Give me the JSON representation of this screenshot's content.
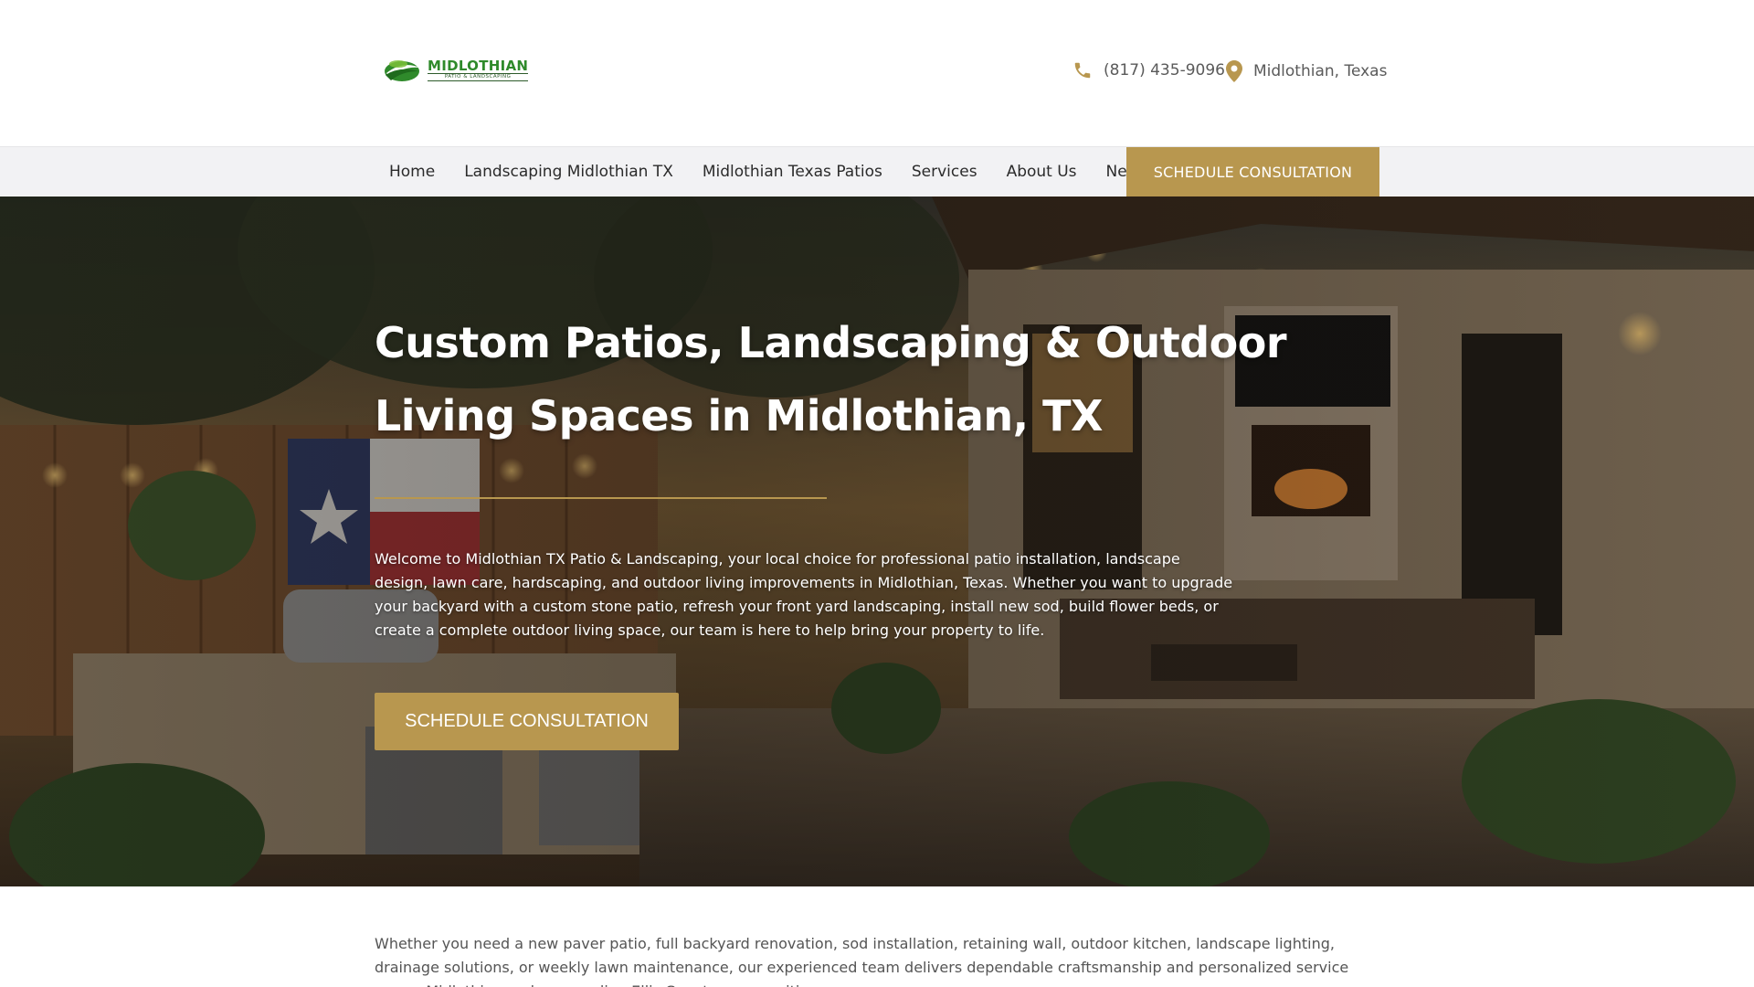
{
  "header": {
    "logo": {
      "name": "MIDLOTHIAN",
      "tagline": "PATIO & LANDSCAPING"
    },
    "phone": "(817) 435-9096",
    "location": "Midlothian, Texas",
    "icons": {
      "phone": "phone-icon",
      "location": "map-pin-icon"
    }
  },
  "nav": {
    "items": [
      {
        "label": "Home"
      },
      {
        "label": "Landscaping Midlothian TX"
      },
      {
        "label": "Midlothian Texas Patios"
      },
      {
        "label": "Services"
      },
      {
        "label": "About Us"
      },
      {
        "label": "News"
      }
    ],
    "cta_label": "SCHEDULE CONSULTATION"
  },
  "hero": {
    "title": "Custom Patios, Landscaping & Outdoor Living Spaces in Midlothian, TX",
    "description": "Welcome to Midlothian TX Patio & Landscaping, your local choice for professional patio installation, landscape design, lawn care, hardscaping, and outdoor living improvements in Midlothian, Texas. Whether you want to upgrade your backyard with a custom stone patio, refresh your front yard landscaping, install new sod, build flower beds, or create a complete outdoor living space, our team is here to help bring your property to life.",
    "cta_label": "SCHEDULE CONSULTATION"
  },
  "intro": {
    "text": "Whether you need a new paver patio, full backyard renovation, sod installation, retaining wall, outdoor kitchen, landscape lighting, drainage solutions, or weekly lawn maintenance, our experienced team delivers dependable craftsmanship and personalized service across Midlothian and surrounding Ellis County communities."
  },
  "colors": {
    "accent": "#b8974f",
    "nav_bg": "#f2f2f4",
    "logo_green": "#2f8a2b",
    "text_dark": "#2b2b2b"
  }
}
